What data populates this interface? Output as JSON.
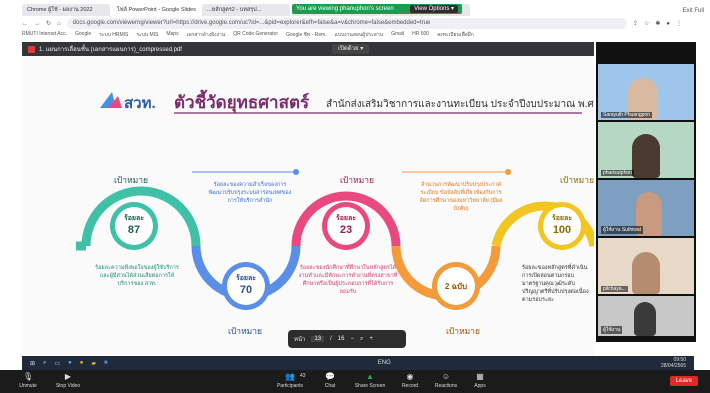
{
  "meeting_banner": {
    "text": "You are viewing phanuphon's screen",
    "options": "View Options ▾"
  },
  "exit_full": "Exit Full",
  "browser": {
    "tabs": [
      "Chrome ผู้ใช้ - ผลงาน 2022",
      "ไฟล์ PowerPoint - Google Slides",
      "...หลักสูตร2 - บทสรุป...",
      "...เรื่องชะลอ...",
      "ไฟล์ตัวอย่าง - Google Sheets"
    ],
    "url": "docs.google.com/viewerng/viewer?url=https://drive.google.com/uc?id=...&pid=explorer&efh=false&a=v&chrome=false&embedded=true",
    "bookmarks": [
      "RMUTI Internet Acc.",
      "Google",
      "ระบบ HRMIS",
      "ระบบ MIS",
      "Maps",
      "เอกสารอ้างอิงงาน",
      "QR Code Generator",
      "Google ชีท - Rem.",
      "แบบงานสอนผู้ประสาน",
      "Gmail",
      "HR 500",
      "ลงทะเบียนเพื่อฝึก"
    ]
  },
  "pdf": {
    "filename": "1. แผนการเลื่อนชั้น (เอกสารแผนการ)_compressed.pdf",
    "open_with": "เปิดด้วย ▾",
    "page_label": "หน้า",
    "page": "13",
    "sep": "/",
    "total": "16"
  },
  "slide": {
    "logo": "สวท.",
    "title_main": "ตัวชี้วัดยุทธศาสตร์",
    "title_sub": "สำนักส่งเสริมวิชาการและงานทะเบียน ประจำปีงบประมาณ พ.ศ.2565",
    "target_word": "เป้าหมาย",
    "unit": "ร้อยละ",
    "milestones": [
      {
        "id": "m1",
        "value": "87",
        "color": "#3ec1a6",
        "desc": "ร้อยละความพึงพอใจของผู้ใช้บริการและผู้มีส่วนได้ส่วนเสียต่อการให้บริการของ สวท."
      },
      {
        "id": "m2",
        "value": "70",
        "color": "#5b8ee6",
        "desc": "ร้อยละของความสำเร็จของการพัฒนาปรับปรุงระบบสารสนเทศของการให้บริการสำนัก"
      },
      {
        "id": "m3",
        "value": "23",
        "color": "#e84a7f",
        "desc": "ร้อยละของนักศึกษาที่ศึกษาในหลักสูตรได้งานทำและมีทักษะการทำงานที่ตรงสาขาที่ศึกษาหรือเป็นผู้ประกอบการที่ได้รับการยอมรับ"
      },
      {
        "id": "m4",
        "value": "2 ฉบับ",
        "color": "#f39a3a",
        "desc": "จำนวนการพัฒนาปรับปรุงประกาศ ระเบียบ ข้อบังคับที่เกี่ยวข้องกับการจัดการศึกษาของมหาวิทยาลัย (มีผลบังคับ)"
      },
      {
        "id": "m5",
        "value": "100",
        "color": "#f2c521",
        "desc": "ร้อยละของหลักสูตรที่ดำเนินการเปิดสอนตามกรอบมาตรฐานคุณวุฒิระดับปริญญาตรีที่ปรับปรุงต่อเนื่องตามรอบระยะ"
      }
    ]
  },
  "participants": [
    {
      "name": "Sarayuth Phuangpon",
      "bg": "#9ec6ea"
    },
    {
      "name": "pharisutphon",
      "bg": "#b7d7c5"
    },
    {
      "name": "ผู้ใช้งาน Suthiwat",
      "bg": "#7f9fc1"
    },
    {
      "name": "pitchaya...",
      "bg": "#e8d8c8"
    },
    {
      "name": "ผู้ใช้งาน",
      "bg": "#c8c8c8"
    }
  ],
  "taskbar": {
    "time": "09:50",
    "date": "28/04/2565",
    "lang": "ENG"
  },
  "controls": {
    "unmute": "Unmute",
    "stop_video": "Stop Video",
    "participants": "Participants",
    "participants_count": "43",
    "chat": "Chat",
    "share": "Share Screen",
    "record": "Record",
    "reactions": "Reactions",
    "apps": "Apps",
    "leave": "Leave"
  }
}
